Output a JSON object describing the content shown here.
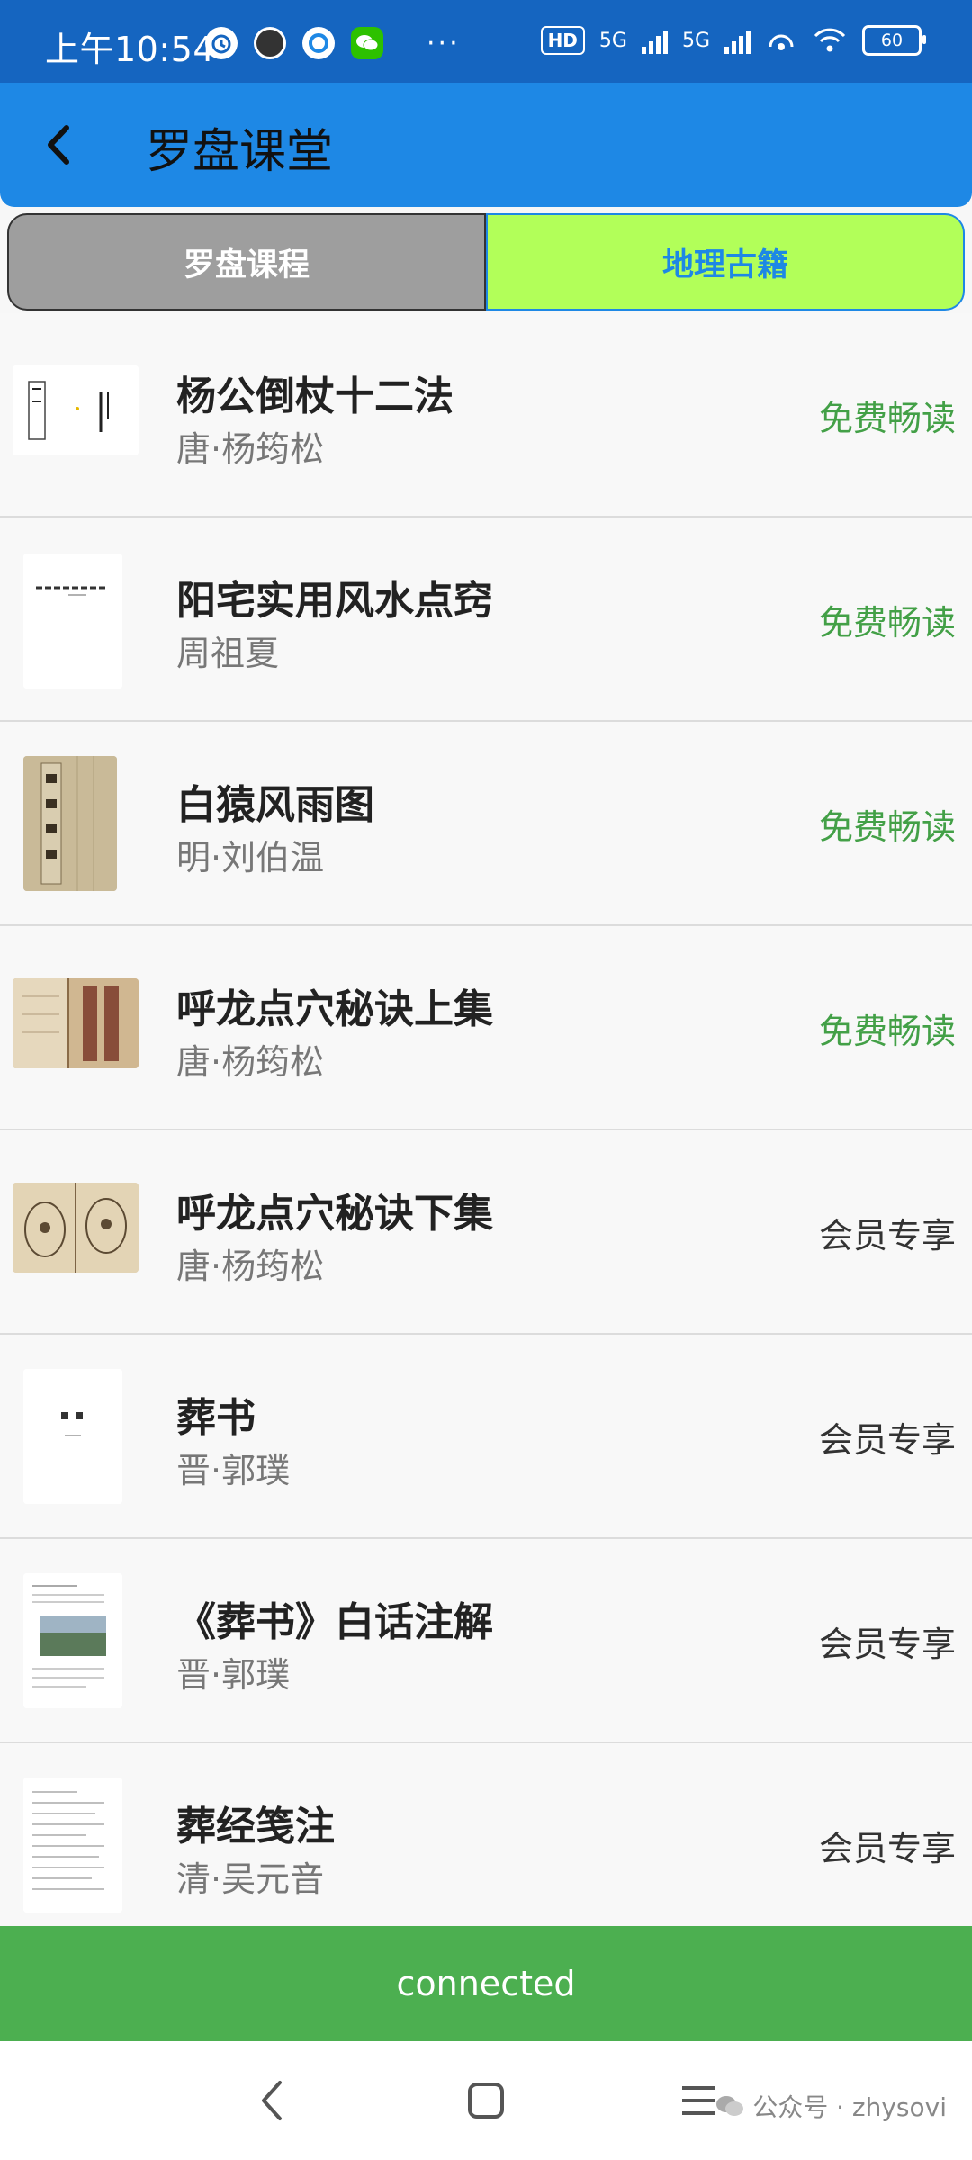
{
  "status_bar": {
    "time": "上午10:54",
    "hd_label": "HD",
    "signal1_label": "5G",
    "signal2_label": "5G",
    "battery": "60"
  },
  "app_bar": {
    "title": "罗盘课堂"
  },
  "tabs": [
    {
      "label": "罗盘课程",
      "selected": false
    },
    {
      "label": "地理古籍",
      "selected": true
    }
  ],
  "books": [
    {
      "title": "杨公倒杖十二法",
      "author": "唐·杨筠松",
      "status": "免费畅读",
      "type": "free"
    },
    {
      "title": "阳宅实用风水点窍",
      "author": "周祖夏",
      "status": "免费畅读",
      "type": "free"
    },
    {
      "title": "白猿风雨图",
      "author": "明·刘伯温",
      "status": "免费畅读",
      "type": "free"
    },
    {
      "title": "呼龙点穴秘诀上集",
      "author": "唐·杨筠松",
      "status": "免费畅读",
      "type": "free"
    },
    {
      "title": "呼龙点穴秘诀下集",
      "author": "唐·杨筠松",
      "status": "会员专享",
      "type": "member"
    },
    {
      "title": "葬书",
      "author": "晋·郭璞",
      "status": "会员专享",
      "type": "member"
    },
    {
      "title": "《葬书》白话注解",
      "author": "晋·郭璞",
      "status": "会员专享",
      "type": "member"
    },
    {
      "title": "葬经笺注",
      "author": "清·吴元音",
      "status": "会员专享",
      "type": "member"
    }
  ],
  "connection": {
    "text": "connected"
  },
  "watermark": {
    "text": "公众号 · zhysovi"
  },
  "colors": {
    "status_bar": "#1565c0",
    "app_bar": "#1e88e5",
    "tab_selected_bg": "#b2ff59",
    "tab_unselected_bg": "#9e9e9e",
    "free_text": "#43a047",
    "connected_bar": "#4caf50"
  }
}
